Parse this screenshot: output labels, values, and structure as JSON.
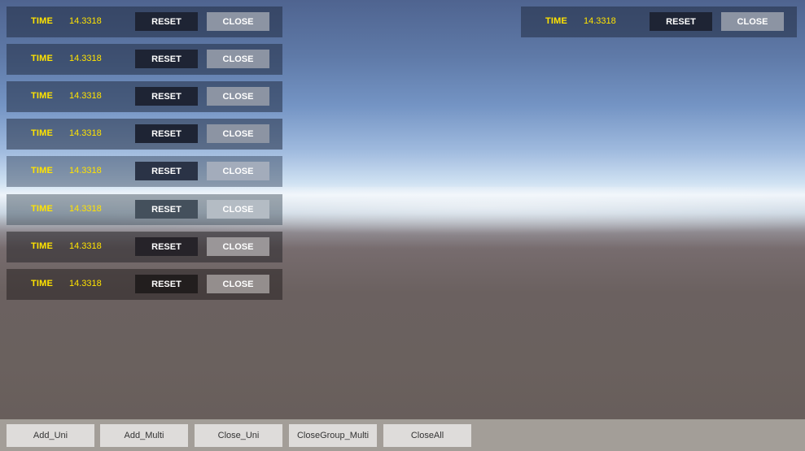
{
  "panels": [
    {
      "time_label": "TIME",
      "time_value": "14.3318",
      "reset_label": "RESET",
      "close_label": "CLOSE"
    },
    {
      "time_label": "TIME",
      "time_value": "14.3318",
      "reset_label": "RESET",
      "close_label": "CLOSE"
    },
    {
      "time_label": "TIME",
      "time_value": "14.3318",
      "reset_label": "RESET",
      "close_label": "CLOSE"
    },
    {
      "time_label": "TIME",
      "time_value": "14.3318",
      "reset_label": "RESET",
      "close_label": "CLOSE"
    },
    {
      "time_label": "TIME",
      "time_value": "14.3318",
      "reset_label": "RESET",
      "close_label": "CLOSE"
    },
    {
      "time_label": "TIME",
      "time_value": "14.3318",
      "reset_label": "RESET",
      "close_label": "CLOSE"
    },
    {
      "time_label": "TIME",
      "time_value": "14.3318",
      "reset_label": "RESET",
      "close_label": "CLOSE"
    },
    {
      "time_label": "TIME",
      "time_value": "14.3318",
      "reset_label": "RESET",
      "close_label": "CLOSE"
    }
  ],
  "right_panel": {
    "time_label": "TIME",
    "time_value": "14.3318",
    "reset_label": "RESET",
    "close_label": "CLOSE"
  },
  "bottom_bar": {
    "add_uni": "Add_Uni",
    "add_multi": "Add_Multi",
    "close_uni": "Close_Uni",
    "closegroup_multi": "CloseGroup_Multi",
    "close_all": "CloseAll"
  },
  "colors": {
    "time_text": "#ffe300",
    "reset_bg": "#1e2434",
    "close_bg": "#8c94a3",
    "bottom_bar_bg": "#a39e98",
    "bottom_button_bg": "#dedcda"
  }
}
